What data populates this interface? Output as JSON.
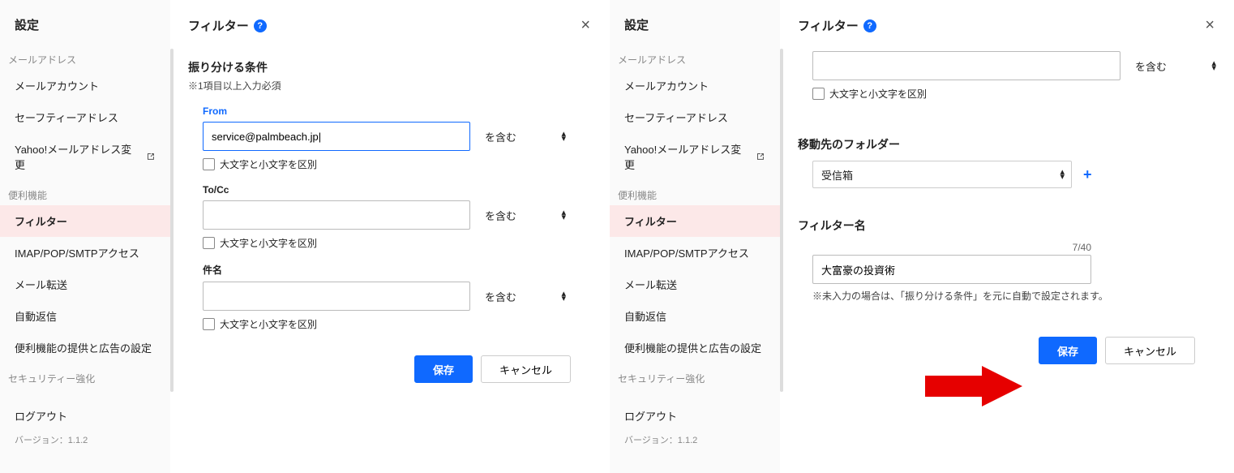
{
  "sidebar": {
    "title": "設定",
    "sections": [
      {
        "label": "メールアドレス",
        "items": [
          {
            "label": "メールアカウント"
          },
          {
            "label": "セーフティーアドレス"
          },
          {
            "label": "Yahoo!メールアドレス変更",
            "external": true
          }
        ]
      },
      {
        "label": "便利機能",
        "items": [
          {
            "label": "フィルター",
            "active": true
          },
          {
            "label": "IMAP/POP/SMTPアクセス"
          },
          {
            "label": "メール転送"
          },
          {
            "label": "自動返信"
          },
          {
            "label": "便利機能の提供と広告の設定"
          }
        ]
      },
      {
        "label": "セキュリティー強化",
        "items": []
      }
    ],
    "logout": "ログアウト",
    "version": "バージョン：1.1.2"
  },
  "left": {
    "title": "フィルター",
    "heading": "振り分ける条件",
    "required_note": "※1項目以上入力必須",
    "fields": {
      "from_label": "From",
      "from_value": "service@palmbeach.jp|",
      "tocc_label": "To/Cc",
      "subject_label": "件名"
    },
    "match_option": "を含む",
    "case_label": "大文字と小文字を区別",
    "save": "保存",
    "cancel": "キャンセル"
  },
  "right": {
    "title": "フィルター",
    "match_option": "を含む",
    "case_label": "大文字と小文字を区別",
    "folder_heading": "移動先のフォルダー",
    "folder_value": "受信箱",
    "name_heading": "フィルター名",
    "name_value": "大富豪の投資術",
    "name_counter": "7/40",
    "name_note": "※未入力の場合は、「振り分ける条件」を元に自動で設定されます。",
    "save": "保存",
    "cancel": "キャンセル"
  }
}
